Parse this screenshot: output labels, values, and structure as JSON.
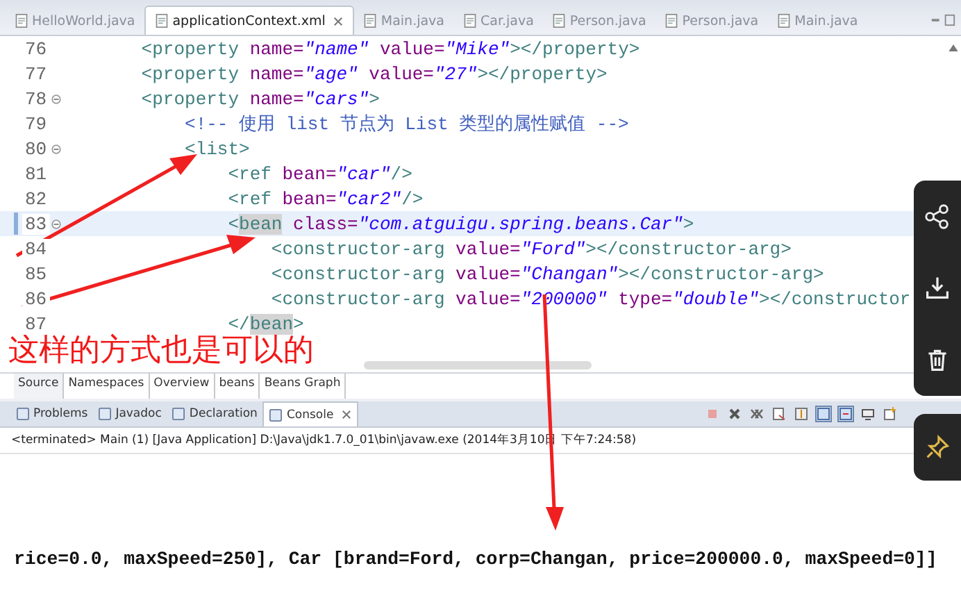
{
  "editor_tabs": [
    {
      "label": "HelloWorld.java",
      "selected": false
    },
    {
      "label": "applicationContext.xml",
      "selected": true
    },
    {
      "label": "Main.java",
      "selected": false
    },
    {
      "label": "Car.java",
      "selected": false
    },
    {
      "label": "Person.java",
      "selected": false
    },
    {
      "label": "Person.java",
      "selected": false
    },
    {
      "label": "Main.java",
      "selected": false
    }
  ],
  "code_lines": [
    {
      "number": "76",
      "foldable": false,
      "current": false,
      "segments": [
        {
          "kind": "tag",
          "text": "      <property "
        },
        {
          "kind": "attr",
          "text": "name="
        },
        {
          "kind": "value",
          "text": "\"name\""
        },
        {
          "kind": "attr",
          "text": " value="
        },
        {
          "kind": "value",
          "text": "\"Mike\""
        },
        {
          "kind": "tag",
          "text": "></property>"
        }
      ]
    },
    {
      "number": "77",
      "foldable": false,
      "current": false,
      "segments": [
        {
          "kind": "tag",
          "text": "      <property "
        },
        {
          "kind": "attr",
          "text": "name="
        },
        {
          "kind": "value",
          "text": "\"age\""
        },
        {
          "kind": "attr",
          "text": " value="
        },
        {
          "kind": "value",
          "text": "\"27\""
        },
        {
          "kind": "tag",
          "text": "></property>"
        }
      ]
    },
    {
      "number": "78",
      "foldable": true,
      "current": false,
      "segments": [
        {
          "kind": "tag",
          "text": "      <property "
        },
        {
          "kind": "attr",
          "text": "name="
        },
        {
          "kind": "value",
          "text": "\"cars\""
        },
        {
          "kind": "tag",
          "text": ">"
        }
      ]
    },
    {
      "number": "79",
      "foldable": false,
      "current": false,
      "segments": [
        {
          "kind": "comment",
          "text": "          <!-- 使用 list 节点为 List 类型的属性赋值 -->"
        }
      ]
    },
    {
      "number": "80",
      "foldable": true,
      "current": false,
      "segments": [
        {
          "kind": "tag",
          "text": "          <list>"
        }
      ]
    },
    {
      "number": "81",
      "foldable": false,
      "current": false,
      "segments": [
        {
          "kind": "tag",
          "text": "              <ref "
        },
        {
          "kind": "attr",
          "text": "bean="
        },
        {
          "kind": "value",
          "text": "\"car\""
        },
        {
          "kind": "tag",
          "text": "/>"
        }
      ]
    },
    {
      "number": "82",
      "foldable": false,
      "current": false,
      "segments": [
        {
          "kind": "tag",
          "text": "              <ref "
        },
        {
          "kind": "attr",
          "text": "bean="
        },
        {
          "kind": "value",
          "text": "\"car2\""
        },
        {
          "kind": "tag",
          "text": "/>"
        }
      ]
    },
    {
      "number": "83",
      "foldable": true,
      "current": true,
      "segments": [
        {
          "kind": "tag",
          "text": "              <"
        },
        {
          "kind": "marked",
          "text": "bean"
        },
        {
          "kind": "attr",
          "text": " class="
        },
        {
          "kind": "value",
          "text": "\"com.atguigu.spring.beans.Car\""
        },
        {
          "kind": "tag",
          "text": ">"
        }
      ]
    },
    {
      "number": "84",
      "foldable": false,
      "current": false,
      "segments": [
        {
          "kind": "tag",
          "text": "                  <constructor-arg "
        },
        {
          "kind": "attr",
          "text": "value="
        },
        {
          "kind": "value",
          "text": "\"Ford\""
        },
        {
          "kind": "tag",
          "text": "></constructor-arg>"
        }
      ]
    },
    {
      "number": "85",
      "foldable": false,
      "current": false,
      "segments": [
        {
          "kind": "tag",
          "text": "                  <constructor-arg "
        },
        {
          "kind": "attr",
          "text": "value="
        },
        {
          "kind": "value",
          "text": "\"Changan\""
        },
        {
          "kind": "tag",
          "text": "></constructor-arg>"
        }
      ]
    },
    {
      "number": "86",
      "foldable": false,
      "current": false,
      "segments": [
        {
          "kind": "tag",
          "text": "                  <constructor-arg "
        },
        {
          "kind": "attr",
          "text": "value="
        },
        {
          "kind": "value",
          "text": "\"200000\""
        },
        {
          "kind": "attr",
          "text": " type="
        },
        {
          "kind": "value",
          "text": "\"double\""
        },
        {
          "kind": "tag",
          "text": "></constructor"
        }
      ]
    },
    {
      "number": "87",
      "foldable": false,
      "current": false,
      "segments": [
        {
          "kind": "tag",
          "text": "              </"
        },
        {
          "kind": "marked",
          "text": "bean"
        },
        {
          "kind": "tag",
          "text": ">"
        }
      ]
    }
  ],
  "annotation": "这样的方式也是可以的",
  "editor_bottom_tabs": [
    {
      "label": "Source",
      "selected": true
    },
    {
      "label": "Namespaces",
      "selected": false
    },
    {
      "label": "Overview",
      "selected": false
    },
    {
      "label": "beans",
      "selected": false
    },
    {
      "label": "Beans Graph",
      "selected": false
    }
  ],
  "view_tabs": [
    {
      "label": "Problems",
      "selected": false
    },
    {
      "label": "Javadoc",
      "selected": false
    },
    {
      "label": "Declaration",
      "selected": false
    },
    {
      "label": "Console",
      "selected": true
    }
  ],
  "console": {
    "status": "<terminated> Main (1) [Java Application] D:\\Java\\jdk1.7.0_01\\bin\\javaw.exe (2014年3月10日 下午7:24:58)",
    "output": "rice=0.0, maxSpeed=250], Car [brand=Ford, corp=Changan, price=200000.0, maxSpeed=0]]"
  }
}
